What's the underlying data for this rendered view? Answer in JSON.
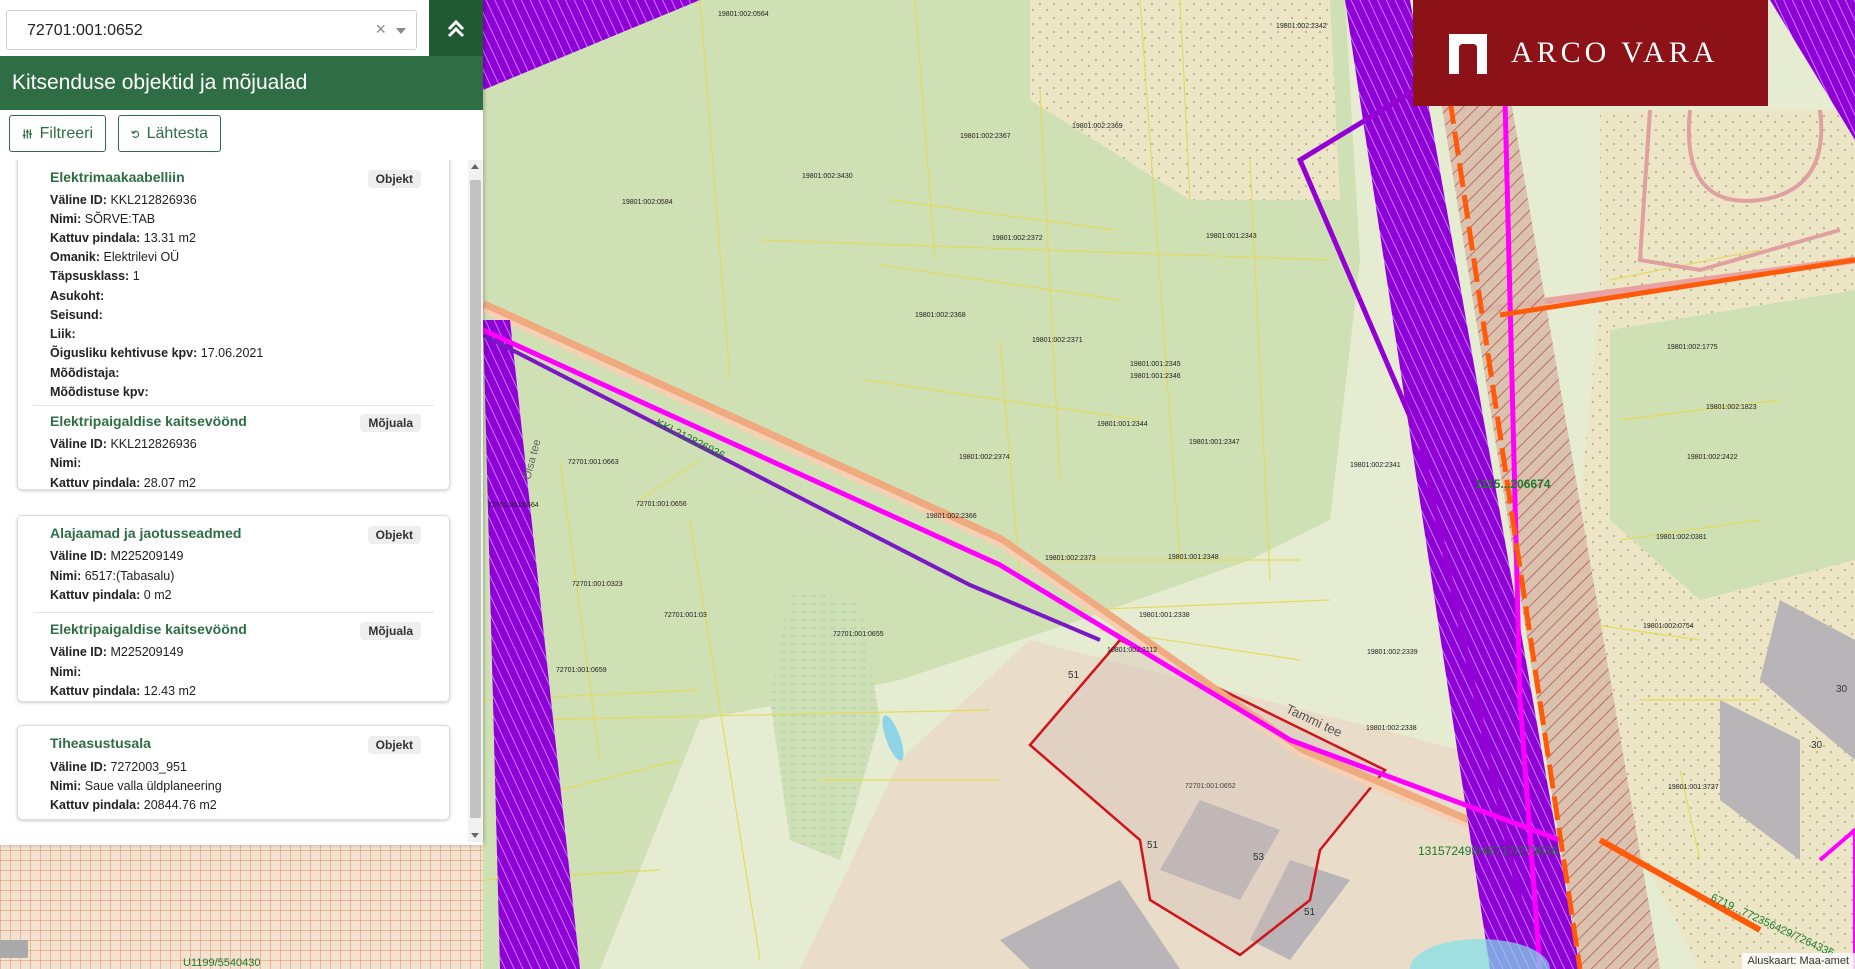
{
  "search": {
    "value": "72701:001:0652",
    "clear_symbol": "×"
  },
  "panel": {
    "title": "Kitsenduse objektid ja mõjualad",
    "filter_label": "Filtreeri",
    "reset_label": "Lähtesta"
  },
  "cards": [
    {
      "entries": [
        {
          "title": "Elektrimaakaabelliin",
          "badge": "Objekt",
          "rows": [
            {
              "label": "Väline ID:",
              "value": "KKL212826936"
            },
            {
              "label": "Nimi:",
              "value": "SÕRVE:TAB"
            },
            {
              "label": "Kattuv pindala:",
              "value": "13.31 m2"
            },
            {
              "label": "Omanik:",
              "value": "Elektrilevi OÜ"
            },
            {
              "label": "Täpsusklass:",
              "value": "1"
            },
            {
              "label": "Asukoht:",
              "value": ""
            },
            {
              "label": "Seisund:",
              "value": ""
            },
            {
              "label": "Liik:",
              "value": ""
            },
            {
              "label": "Õigusliku kehtivuse kpv:",
              "value": "17.06.2021"
            },
            {
              "label": "Mõõdistaja:",
              "value": ""
            },
            {
              "label": "Mõõdistuse kpv:",
              "value": ""
            }
          ]
        },
        {
          "title": "Elektripaigaldise kaitsevöönd",
          "badge": "Mõjuala",
          "rows": [
            {
              "label": "Väline ID:",
              "value": "KKL212826936"
            },
            {
              "label": "Nimi:",
              "value": ""
            },
            {
              "label": "Kattuv pindala:",
              "value": "28.07 m2"
            }
          ]
        }
      ]
    },
    {
      "entries": [
        {
          "title": "Alajaamad ja jaotusseadmed",
          "badge": "Objekt",
          "rows": [
            {
              "label": "Väline ID:",
              "value": "M225209149"
            },
            {
              "label": "Nimi:",
              "value": "6517:(Tabasalu)"
            },
            {
              "label": "Kattuv pindala:",
              "value": "0 m2"
            }
          ]
        },
        {
          "title": "Elektripaigaldise kaitsevöönd",
          "badge": "Mõjuala",
          "rows": [
            {
              "label": "Väline ID:",
              "value": "M225209149"
            },
            {
              "label": "Nimi:",
              "value": ""
            },
            {
              "label": "Kattuv pindala:",
              "value": "12.43 m2"
            }
          ]
        }
      ]
    },
    {
      "entries": [
        {
          "title": "Tiheasustusala",
          "badge": "Objekt",
          "rows": [
            {
              "label": "Väline ID:",
              "value": "7272003_951"
            },
            {
              "label": "Nimi:",
              "value": "Saue valla üldplaneering"
            },
            {
              "label": "Kattuv pindala:",
              "value": "20844.76 m2"
            }
          ]
        }
      ]
    }
  ],
  "logo": {
    "text": "ARCO VARA",
    "color": "#8c1218"
  },
  "attribution": "Aluskaart: Maa-amet",
  "map_labels": {
    "road_tammi": "Tammi tee",
    "road_olsa": "Ölsa tee",
    "cable_id": "KKL212826936",
    "parcel_selected": "72701:001:0652",
    "line_1": "1115...206674",
    "line_2": "131572493/46717/273636",
    "line_3": "6719...772356429/7264336",
    "bottom_id": "U1199/5540430",
    "parcels": [
      "19801:002:0564",
      "19801:002:2342",
      "19801:002:2367",
      "19801:002:2369",
      "19801:002:3430",
      "19801:002:0584",
      "19801:002:2372",
      "19801:001:2343",
      "19801:002:2368",
      "19801:002:2371",
      "19801:001:2345",
      "19801:001:2346",
      "19801:001:2344",
      "19801:001:2347",
      "19801:002:2374",
      "19801:002:2366",
      "19801:002:2373",
      "19801:001:2348",
      "19801:001:2338",
      "19801:002:2339",
      "19801:002:2338",
      "19801:002:2341",
      "19801:002:1775",
      "19801:002:1823",
      "19801:002:2422",
      "19801:002:0381",
      "19801:002:0754",
      "19801:001:3737",
      "72701:001:0663",
      "72701:001:0656",
      "72701:001:0664",
      "72701:001:0323",
      "72701:001:03",
      "72701:001:0655",
      "72701:001:0659",
      "10801:002:2112"
    ],
    "building_nums": [
      "30",
      "30",
      "53",
      "51",
      "51",
      "51"
    ]
  },
  "colors": {
    "forest": "#cfe0b4",
    "field": "#e6ecd1",
    "protection_zone": "#9400d3",
    "cable": "#ff00ff",
    "parcel_border": "#e8e06a",
    "selected_parcel": "#d0141c",
    "road": "#f2b58a",
    "header_green": "#2f6e44"
  }
}
